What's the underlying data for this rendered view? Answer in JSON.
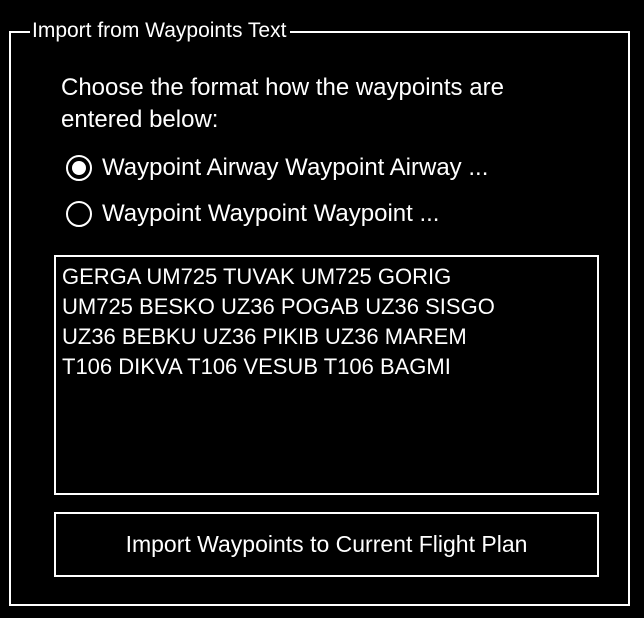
{
  "group": {
    "title": "Import from Waypoints Text"
  },
  "instructions": {
    "line1": "Choose the format how the waypoints are",
    "line2": "entered below:"
  },
  "format_options": [
    {
      "label": "Waypoint Airway Waypoint Airway ...",
      "selected": true
    },
    {
      "label": "Waypoint Waypoint Waypoint ...",
      "selected": false
    }
  ],
  "waypoints_text": {
    "value": "GERGA UM725 TUVAK UM725 GORIG\nUM725 BESKO UZ36 POGAB UZ36 SISGO\nUZ36 BEBKU UZ36 PIKIB UZ36 MAREM\nT106 DIKVA T106 VESUB T106 BAGMI"
  },
  "import_button": {
    "label": "Import Waypoints to Current Flight Plan"
  },
  "colors": {
    "background": "#000000",
    "foreground": "#ffffff"
  }
}
